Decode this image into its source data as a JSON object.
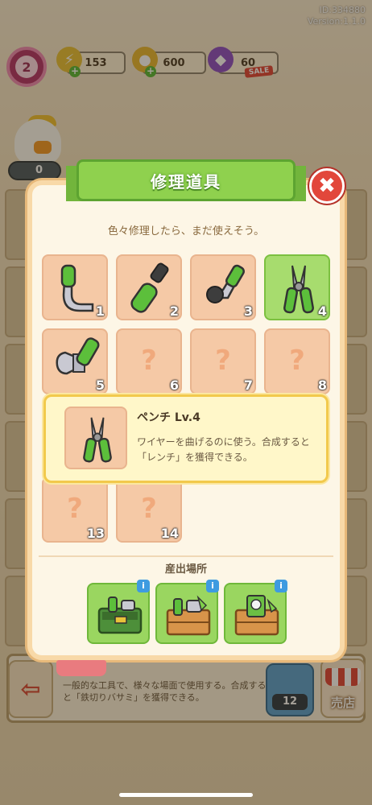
{
  "header": {
    "id_text": "ID:334880",
    "version_text": "Version:1.1.0"
  },
  "hud": {
    "level": "2",
    "energy": "153",
    "coins": "600",
    "gems": "60",
    "sale_label": "SALE",
    "duck_counter": "0",
    "coin_button_count": "12"
  },
  "modal": {
    "title": "修理道具",
    "subtitle": "色々修理したら、まだ使えそう。",
    "slots": [
      {
        "num": "1",
        "known": true,
        "item": "bent-pipe"
      },
      {
        "num": "2",
        "known": true,
        "item": "screwdriver"
      },
      {
        "num": "3",
        "known": true,
        "item": "hex-key"
      },
      {
        "num": "4",
        "known": true,
        "item": "pliers",
        "selected": true
      },
      {
        "num": "5",
        "known": true,
        "item": "wrench"
      },
      {
        "num": "6",
        "known": false
      },
      {
        "num": "7",
        "known": false
      },
      {
        "num": "8",
        "known": false
      },
      {
        "num": "13",
        "known": false
      },
      {
        "num": "14",
        "known": false
      }
    ],
    "unknown_glyph": "?",
    "detail": {
      "name": "ペンチ Lv.4",
      "description": "ワイヤーを曲げるのに使う。合成すると「レンチ」を獲得できる。"
    },
    "source_title": "産出場所",
    "sources": [
      {
        "name": "toolbox"
      },
      {
        "name": "crate-1"
      },
      {
        "name": "crate-2"
      }
    ],
    "info_glyph": "i",
    "close_glyph": "✖"
  },
  "bottom": {
    "description": "一般的な工具で、様々な場面で使用する。合成すると「鉄切りバサミ」を獲得できる。",
    "shop_label": "売店",
    "back_glyph": "⇦"
  },
  "colors": {
    "accent_green": "#8fd14e",
    "close_red": "#e2473b",
    "slot_peach": "#f5c9a6",
    "selected_green": "#a7dc6e"
  }
}
